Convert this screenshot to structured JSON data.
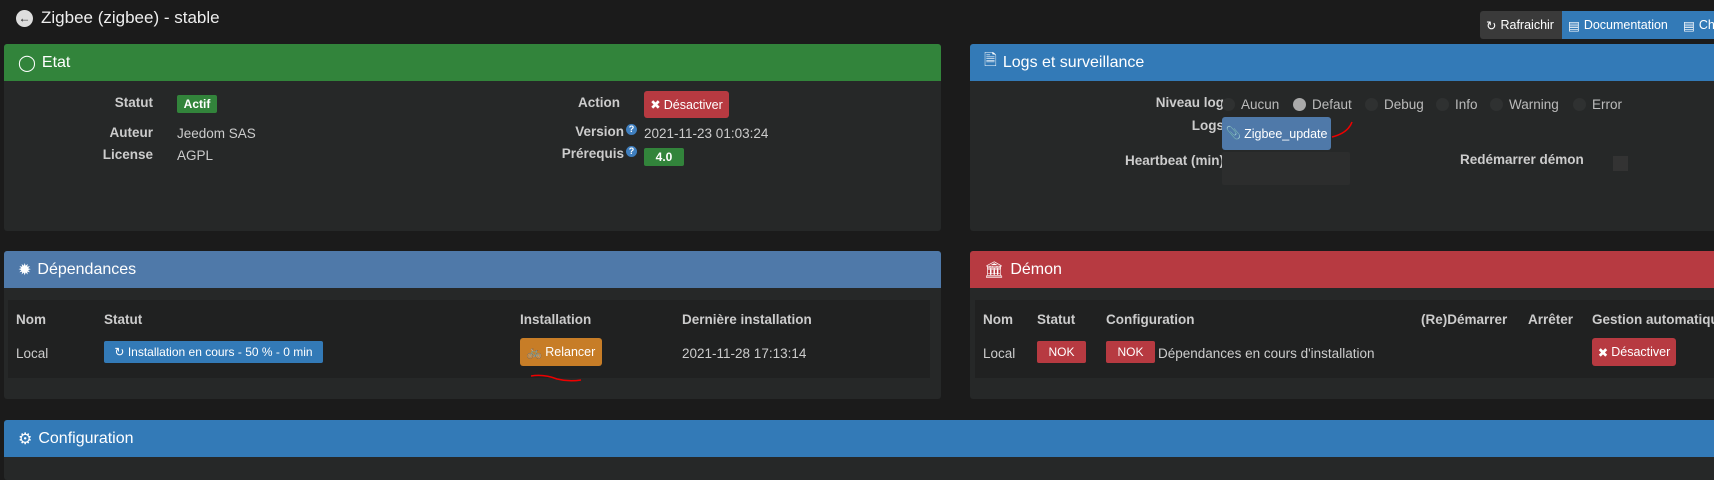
{
  "header": {
    "title": "Zigbee (zigbee) - stable",
    "buttons": {
      "refresh": "Rafraichir",
      "doc": "Documentation",
      "changelog": "Cha"
    }
  },
  "etat": {
    "title": "Etat",
    "statut_label": "Statut",
    "statut_value": "Actif",
    "auteur_label": "Auteur",
    "auteur_value": "Jeedom SAS",
    "license_label": "License",
    "license_value": "AGPL",
    "action_label": "Action",
    "action_button": "Désactiver",
    "version_label": "Version",
    "version_value": "2021-11-23 01:03:24",
    "prerequis_label": "Prérequis",
    "prerequis_value": "4.0",
    "help": "?"
  },
  "logs": {
    "title": "Logs et surveillance",
    "niveau_label": "Niveau log",
    "levels": [
      "Aucun",
      "Defaut",
      "Debug",
      "Info",
      "Warning",
      "Error"
    ],
    "selected": "Defaut",
    "logs_label": "Logs",
    "log_button": "Zigbee_update",
    "heartbeat_label": "Heartbeat (min)",
    "heartbeat_value": "",
    "restart_label": "Redémarrer démon"
  },
  "deps": {
    "title": "Dépendances",
    "headers": [
      "Nom",
      "Statut",
      "Installation",
      "Dernière installation"
    ],
    "row": {
      "nom": "Local",
      "statut": "Installation en cours - 50 % - 0 min",
      "install_button": "Relancer",
      "last": "2021-11-28 17:13:14"
    }
  },
  "demon": {
    "title": "Démon",
    "headers": [
      "Nom",
      "Statut",
      "Configuration",
      "(Re)Démarrer",
      "Arrêter",
      "Gestion automatiqu"
    ],
    "row": {
      "nom": "Local",
      "statut": "NOK",
      "config_badge": "NOK",
      "config_text": "Dépendances en cours d'installation",
      "auto_button": "Désactiver"
    }
  },
  "config": {
    "title": "Configuration"
  },
  "colors": {
    "green": "#32843b",
    "blue": "#337ab7",
    "depblue": "#4f79a9",
    "red": "#b73a41",
    "orange": "#c77d27"
  }
}
